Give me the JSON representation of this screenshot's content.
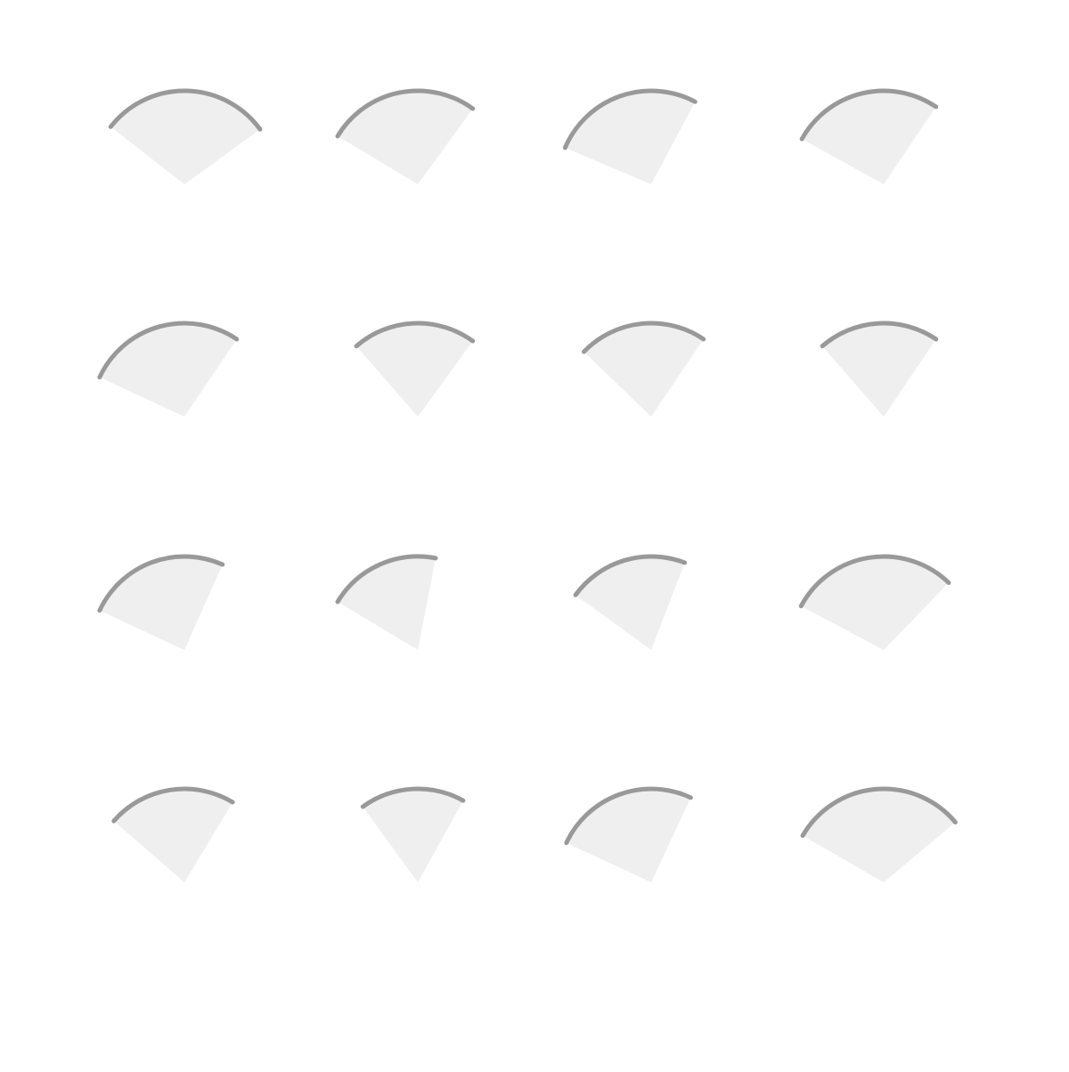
{
  "colors": {
    "background": "#ffffff",
    "wedge_fill": "#efefef",
    "arc_stroke": "#999999"
  },
  "grid": {
    "rows": 4,
    "columns": 4,
    "count": 16
  },
  "wedges": [
    {
      "row": 1,
      "col": 1,
      "start_deg": 36,
      "end_deg": 142,
      "icon": "sector-icon"
    },
    {
      "row": 1,
      "col": 2,
      "start_deg": 54,
      "end_deg": 149,
      "icon": "sector-icon"
    },
    {
      "row": 1,
      "col": 3,
      "start_deg": 62,
      "end_deg": 157,
      "icon": "sector-icon"
    },
    {
      "row": 1,
      "col": 4,
      "start_deg": 56,
      "end_deg": 151,
      "icon": "sector-icon"
    },
    {
      "row": 2,
      "col": 1,
      "start_deg": 56,
      "end_deg": 155,
      "icon": "sector-icon"
    },
    {
      "row": 2,
      "col": 2,
      "start_deg": 54,
      "end_deg": 131,
      "icon": "sector-icon"
    },
    {
      "row": 2,
      "col": 3,
      "start_deg": 56,
      "end_deg": 136,
      "icon": "sector-icon"
    },
    {
      "row": 2,
      "col": 4,
      "start_deg": 56,
      "end_deg": 131,
      "icon": "sector-icon"
    },
    {
      "row": 3,
      "col": 1,
      "start_deg": 66,
      "end_deg": 155,
      "icon": "sector-icon"
    },
    {
      "row": 3,
      "col": 2,
      "start_deg": 79,
      "end_deg": 149,
      "icon": "sector-icon"
    },
    {
      "row": 3,
      "col": 3,
      "start_deg": 69,
      "end_deg": 144,
      "icon": "sector-icon"
    },
    {
      "row": 3,
      "col": 4,
      "start_deg": 46,
      "end_deg": 152,
      "icon": "sector-icon"
    },
    {
      "row": 4,
      "col": 1,
      "start_deg": 59,
      "end_deg": 139,
      "icon": "sector-icon"
    },
    {
      "row": 4,
      "col": 2,
      "start_deg": 61,
      "end_deg": 126,
      "icon": "sector-icon"
    },
    {
      "row": 4,
      "col": 3,
      "start_deg": 65,
      "end_deg": 155,
      "icon": "sector-icon"
    },
    {
      "row": 4,
      "col": 4,
      "start_deg": 40,
      "end_deg": 150,
      "icon": "sector-icon"
    }
  ]
}
